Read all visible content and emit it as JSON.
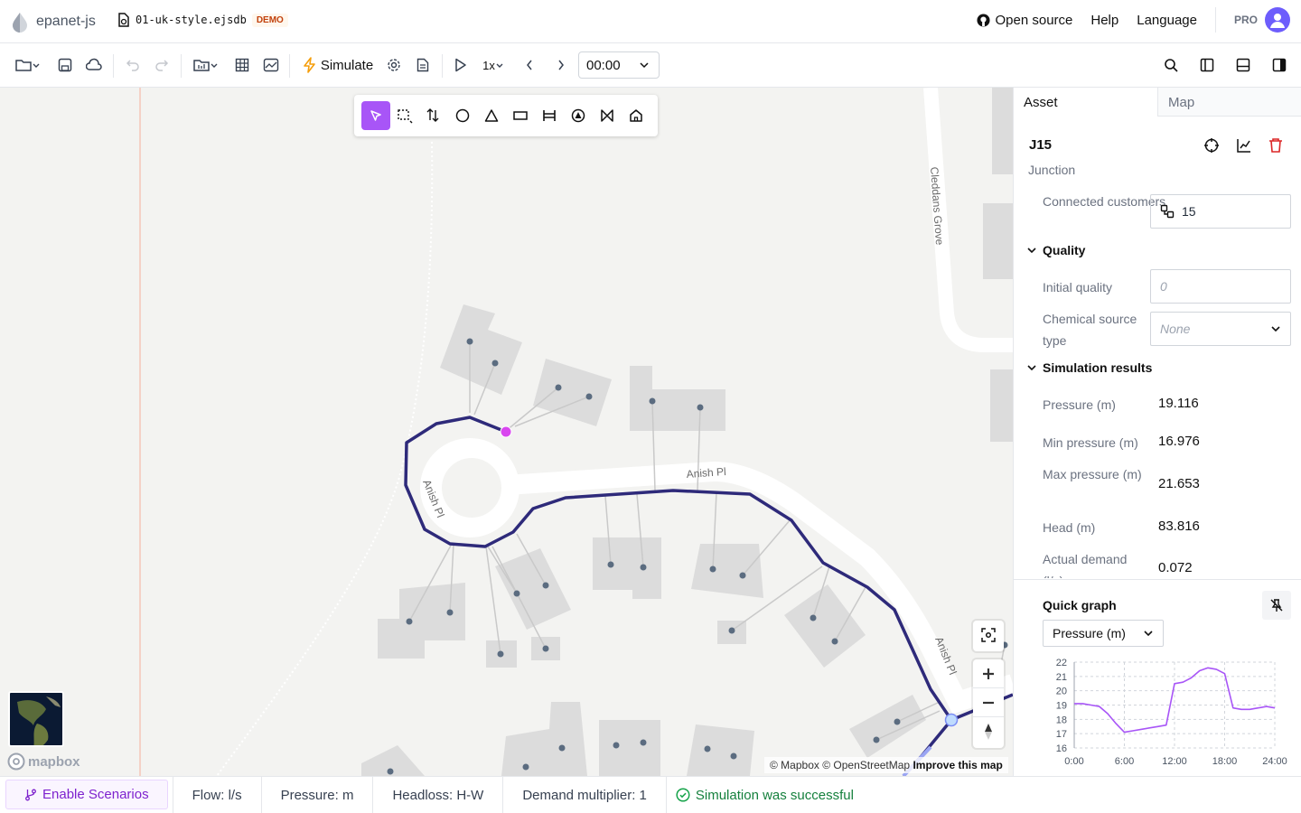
{
  "header": {
    "app_name": "epanet-js",
    "file_name": "01-uk-style.ejsdb",
    "badge": "DEMO",
    "links": {
      "open_source": "Open source",
      "help": "Help",
      "language": "Language"
    },
    "plan": "PRO"
  },
  "toolbar": {
    "simulate_label": "Simulate",
    "speed": "1x",
    "time": "00:00"
  },
  "map": {
    "street_labels": [
      "Cleddans Grove",
      "Anish Pl",
      "Anish Pl",
      "Anish Pl"
    ],
    "attribution": {
      "mapbox": "© Mapbox",
      "osm": "© OpenStreetMap",
      "improve": "Improve this map"
    },
    "logo": "mapbox"
  },
  "panel": {
    "tabs": [
      "Asset",
      "Map"
    ],
    "asset_id": "J15",
    "asset_type": "Junction",
    "connected_customers_label": "Connected customers",
    "connected_customers_value": "15",
    "quality_section": "Quality",
    "initial_quality_label": "Initial quality",
    "initial_quality_placeholder": "0",
    "chemical_source_label": "Chemical source type",
    "chemical_source_value": "None",
    "results_section": "Simulation results",
    "results": [
      {
        "label": "Pressure (m)",
        "value": "19.116"
      },
      {
        "label": "Min pressure (m)",
        "value": "16.976"
      },
      {
        "label": "Max pressure (m)",
        "value": "21.653"
      },
      {
        "label": "Head (m)",
        "value": "83.816"
      },
      {
        "label": "Actual demand (l/s)",
        "value": "0.072"
      }
    ],
    "quick_graph": {
      "title": "Quick graph",
      "selected": "Pressure (m)"
    }
  },
  "chart_data": {
    "type": "line",
    "title": "",
    "xlabel": "",
    "ylabel": "",
    "ylim": [
      16,
      22
    ],
    "y_ticks": [
      "16",
      "17",
      "18",
      "19",
      "20",
      "21",
      "22"
    ],
    "x_ticks": [
      "0:00",
      "6:00",
      "12:00",
      "18:00",
      "24:00"
    ],
    "x_hours": [
      0,
      1,
      2,
      3,
      4,
      5,
      6,
      7,
      8,
      9,
      10,
      11,
      12,
      13,
      14,
      15,
      16,
      17,
      18,
      19,
      20,
      21,
      22,
      23,
      24
    ],
    "series": [
      {
        "color": "#a855f7",
        "values": [
          19.1,
          19.1,
          19.0,
          18.9,
          18.4,
          17.7,
          17.1,
          17.2,
          17.3,
          17.4,
          17.5,
          17.6,
          20.5,
          20.6,
          20.9,
          21.4,
          21.6,
          21.5,
          21.2,
          18.8,
          18.7,
          18.7,
          18.8,
          18.9,
          18.8
        ]
      }
    ]
  },
  "statusbar": {
    "scenarios": "Enable Scenarios",
    "flow": "Flow: l/s",
    "pressure": "Pressure: m",
    "headloss": "Headloss: H-W",
    "demand": "Demand multiplier: 1",
    "sim_status": "Simulation was successful"
  },
  "colors": {
    "accent": "#a855f7",
    "pipe": "#2e2a7a",
    "selected_node": "#d946ef",
    "success": "#16a34a",
    "delete": "#dc2626"
  }
}
